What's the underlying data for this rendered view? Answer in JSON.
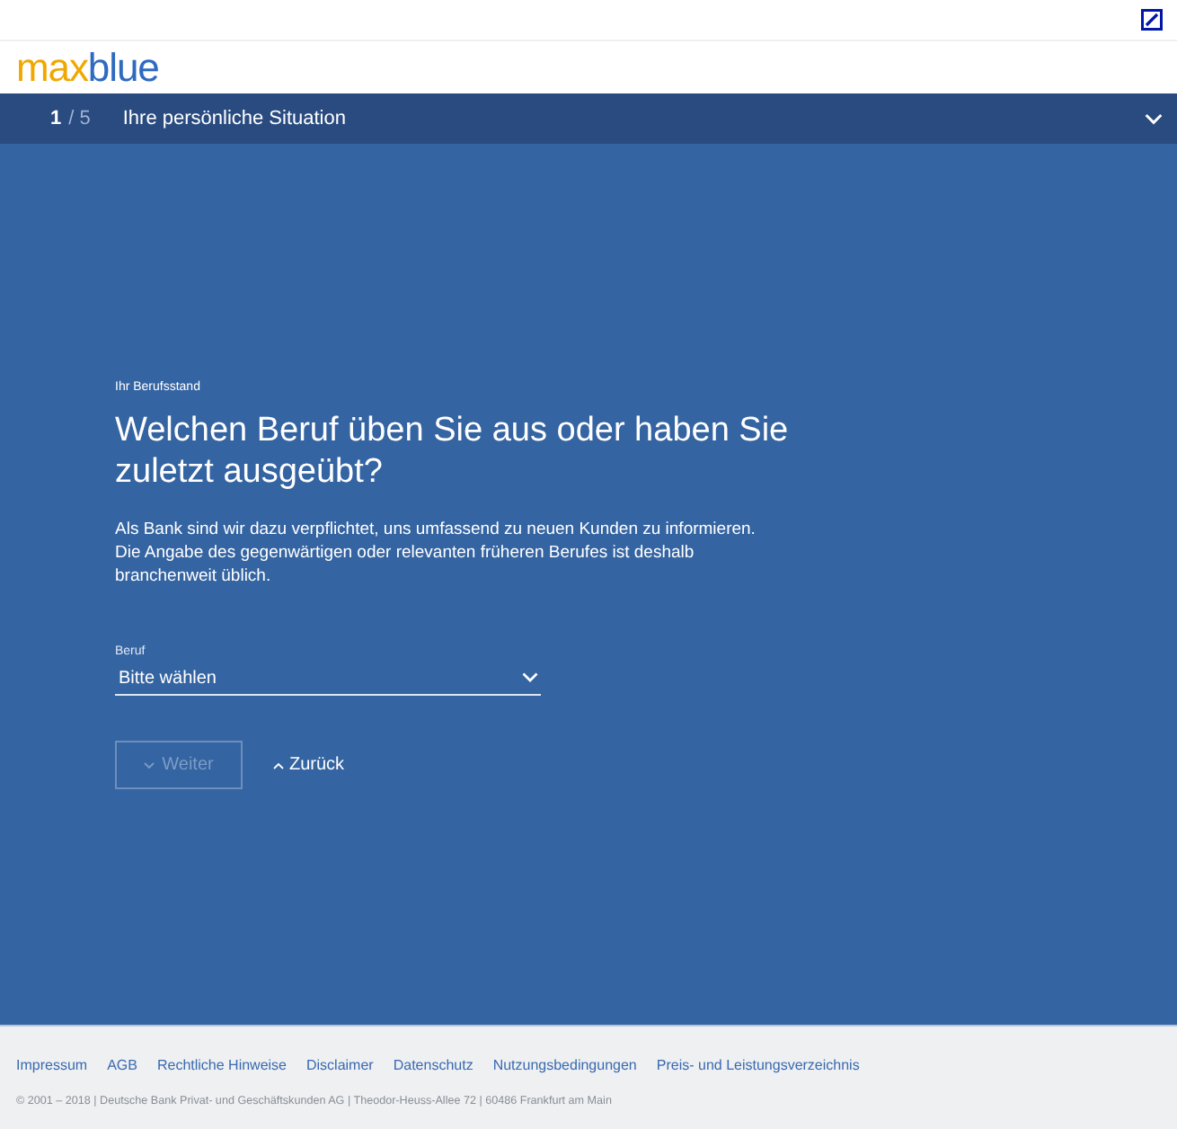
{
  "header": {
    "logo": {
      "first": "max",
      "second": "blue"
    }
  },
  "step_bar": {
    "current": "1",
    "total": "/ 5",
    "title": "Ihre persönliche Situation",
    "expanded": false
  },
  "form": {
    "eyebrow": "Ihr Berufsstand",
    "heading": "Welchen Beruf üben Sie aus oder haben Sie zuletzt ausgeübt?",
    "description": "Als Bank sind wir dazu verpflichtet, uns umfassend zu neuen Kunden zu informieren. Die Angabe des gegenwärtigen oder relevanten früheren Berufes ist deshalb branchenweit üblich.",
    "select": {
      "label": "Beruf",
      "value": "Bitte wählen"
    },
    "next_button": {
      "label": "Weiter",
      "disabled": true
    },
    "back_link": {
      "label": "Zurück"
    }
  },
  "footer": {
    "links": [
      "Impressum",
      "AGB",
      "Rechtliche Hinweise",
      "Disclaimer",
      "Datenschutz",
      "Nutzungsbedingungen",
      "Preis- und Leistungsverzeichnis"
    ],
    "copyright": "© 2001 – 2018 | Deutsche Bank Privat- und Geschäftskunden AG | Theodor-Heuss-Allee 72 | 60486 Frankfurt am Main"
  }
}
